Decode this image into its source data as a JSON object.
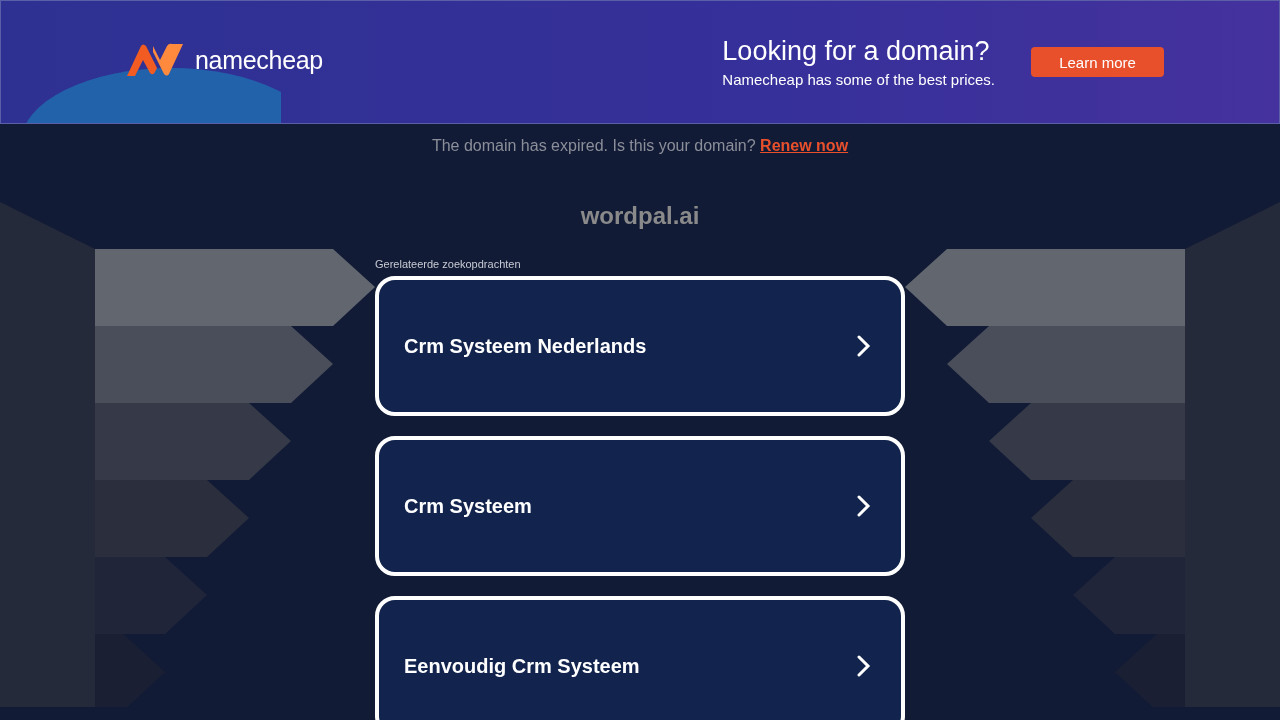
{
  "banner": {
    "logo_text": "namecheap",
    "headline": "Looking for a domain?",
    "subline": "Namecheap has some of the best prices.",
    "button": "Learn more"
  },
  "notice": {
    "text": "The domain has expired. Is this your domain?",
    "link": "Renew now"
  },
  "domain": "wordpal.ai",
  "related": {
    "label": "Gerelateerde zoekopdrachten",
    "items": [
      {
        "text": "Crm Systeem Nederlands"
      },
      {
        "text": "Crm Systeem"
      },
      {
        "text": "Eenvoudig Crm Systeem"
      }
    ]
  }
}
